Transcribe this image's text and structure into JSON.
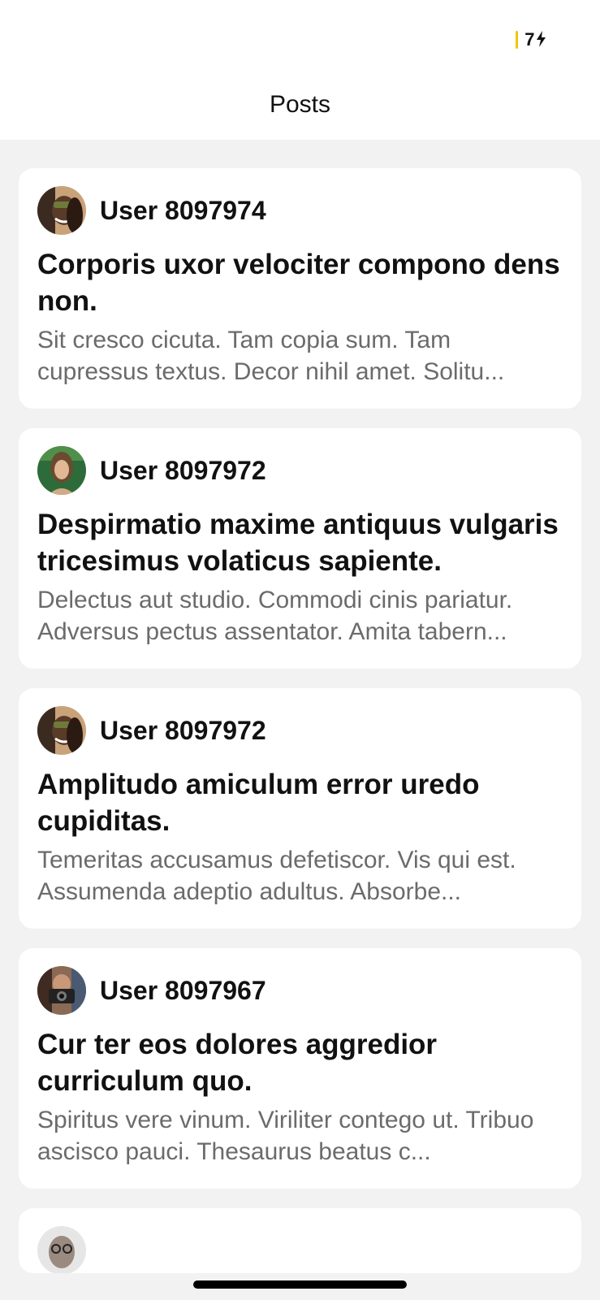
{
  "status": {
    "battery_level": "7"
  },
  "header": {
    "title": "Posts"
  },
  "posts": [
    {
      "user": "User 8097974",
      "title": "Corporis uxor velociter compono dens non.",
      "body": "Sit cresco cicuta. Tam copia sum. Tam cupressus textus. Decor nihil amet. Solitu..."
    },
    {
      "user": "User 8097972",
      "title": "Despirmatio maxime antiquus vulgaris tricesimus volaticus sapiente.",
      "body": "Delectus aut studio. Commodi cinis pariatur. Adversus pectus assentator. Amita tabern..."
    },
    {
      "user": "User 8097972",
      "title": "Amplitudo amiculum error uredo cupiditas.",
      "body": "Temeritas accusamus defetiscor. Vis qui est. Assumenda adeptio adultus. Absorbe..."
    },
    {
      "user": "User 8097967",
      "title": "Cur ter eos dolores aggredior curriculum quo.",
      "body": "Spiritus vere vinum. Viriliter contego ut. Tribuo ascisco pauci. Thesaurus beatus c..."
    }
  ],
  "colors": {
    "accent": "#f5c400",
    "card": "#ffffff",
    "background": "#f2f2f2",
    "muted_text": "#6b6b6b"
  }
}
